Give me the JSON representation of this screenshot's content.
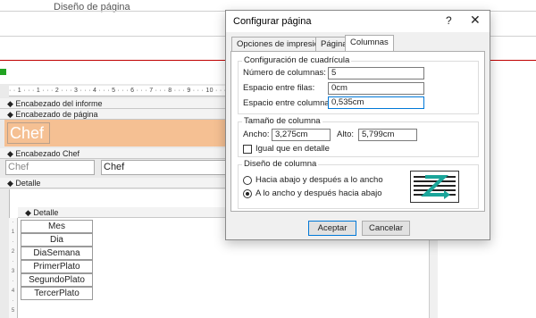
{
  "ribbon": {
    "tab_label": "Diseño de página"
  },
  "ruler": {
    "ticks": "· · 1 · · · 1 · · · 2 · · · 3 · · · 4 · · · 5 · · · 6 · · · 7 · · · 8 · · · 9 · · · 10 · · · 11 · · · 12 · · · 13 · · · 14 · · · 15 · · · 16 · · · 17 · · · 18 · · · 19 · · · 20 · · · 21 · · · 22"
  },
  "sections": {
    "report_header": "Encabezado del informe",
    "page_header": "Encabezado de página",
    "chef_header": "Encabezado Chef",
    "detail": "Detalle",
    "detail_sub": "Detalle"
  },
  "controls": {
    "chef_big": "Chef",
    "chef_label": "Chef",
    "chef_field": "Chef"
  },
  "detail_fields": [
    "Mes",
    "Dia",
    "DiaSemana",
    "PrimerPlato",
    "SegundoPlato",
    "TercerPlato"
  ],
  "dialog": {
    "title": "Configurar página",
    "help": "?",
    "close": "✕",
    "tabs": [
      "Opciones de impresión",
      "Página",
      "Columnas"
    ],
    "grid": {
      "title": "Configuración de cuadrícula",
      "num_columns_label": "Número de columnas:",
      "num_columns_value": "5",
      "row_spacing_label": "Espacio entre filas:",
      "row_spacing_value": "0cm",
      "column_spacing_label": "Espacio entre columnas:",
      "column_spacing_value": "0,535cm"
    },
    "size": {
      "title": "Tamaño de columna",
      "width_label": "Ancho:",
      "width_value": "3,275cm",
      "height_label": "Alto:",
      "height_value": "5,799cm",
      "same_as_detail_label": "Igual que en detalle"
    },
    "layout": {
      "title": "Diseño de columna",
      "option1": "Hacia abajo y después a lo ancho",
      "option2": "A lo ancho y después hacia abajo"
    },
    "ok": "Aceptar",
    "cancel": "Cancelar"
  }
}
